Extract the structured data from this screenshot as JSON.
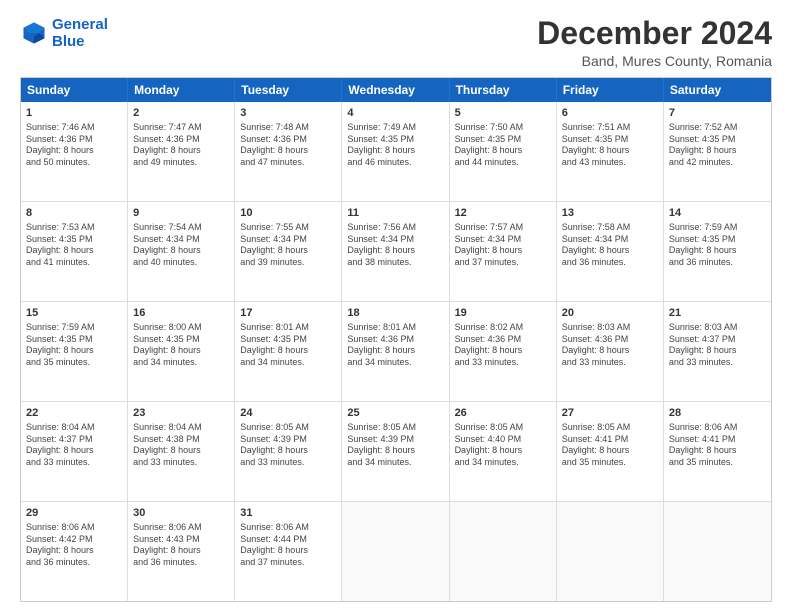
{
  "logo": {
    "line1": "General",
    "line2": "Blue"
  },
  "header": {
    "title": "December 2024",
    "subtitle": "Band, Mures County, Romania"
  },
  "days_of_week": [
    "Sunday",
    "Monday",
    "Tuesday",
    "Wednesday",
    "Thursday",
    "Friday",
    "Saturday"
  ],
  "weeks": [
    [
      {
        "day": "1",
        "lines": [
          "Sunrise: 7:46 AM",
          "Sunset: 4:36 PM",
          "Daylight: 8 hours",
          "and 50 minutes."
        ]
      },
      {
        "day": "2",
        "lines": [
          "Sunrise: 7:47 AM",
          "Sunset: 4:36 PM",
          "Daylight: 8 hours",
          "and 49 minutes."
        ]
      },
      {
        "day": "3",
        "lines": [
          "Sunrise: 7:48 AM",
          "Sunset: 4:36 PM",
          "Daylight: 8 hours",
          "and 47 minutes."
        ]
      },
      {
        "day": "4",
        "lines": [
          "Sunrise: 7:49 AM",
          "Sunset: 4:35 PM",
          "Daylight: 8 hours",
          "and 46 minutes."
        ]
      },
      {
        "day": "5",
        "lines": [
          "Sunrise: 7:50 AM",
          "Sunset: 4:35 PM",
          "Daylight: 8 hours",
          "and 44 minutes."
        ]
      },
      {
        "day": "6",
        "lines": [
          "Sunrise: 7:51 AM",
          "Sunset: 4:35 PM",
          "Daylight: 8 hours",
          "and 43 minutes."
        ]
      },
      {
        "day": "7",
        "lines": [
          "Sunrise: 7:52 AM",
          "Sunset: 4:35 PM",
          "Daylight: 8 hours",
          "and 42 minutes."
        ]
      }
    ],
    [
      {
        "day": "8",
        "lines": [
          "Sunrise: 7:53 AM",
          "Sunset: 4:35 PM",
          "Daylight: 8 hours",
          "and 41 minutes."
        ]
      },
      {
        "day": "9",
        "lines": [
          "Sunrise: 7:54 AM",
          "Sunset: 4:34 PM",
          "Daylight: 8 hours",
          "and 40 minutes."
        ]
      },
      {
        "day": "10",
        "lines": [
          "Sunrise: 7:55 AM",
          "Sunset: 4:34 PM",
          "Daylight: 8 hours",
          "and 39 minutes."
        ]
      },
      {
        "day": "11",
        "lines": [
          "Sunrise: 7:56 AM",
          "Sunset: 4:34 PM",
          "Daylight: 8 hours",
          "and 38 minutes."
        ]
      },
      {
        "day": "12",
        "lines": [
          "Sunrise: 7:57 AM",
          "Sunset: 4:34 PM",
          "Daylight: 8 hours",
          "and 37 minutes."
        ]
      },
      {
        "day": "13",
        "lines": [
          "Sunrise: 7:58 AM",
          "Sunset: 4:34 PM",
          "Daylight: 8 hours",
          "and 36 minutes."
        ]
      },
      {
        "day": "14",
        "lines": [
          "Sunrise: 7:59 AM",
          "Sunset: 4:35 PM",
          "Daylight: 8 hours",
          "and 36 minutes."
        ]
      }
    ],
    [
      {
        "day": "15",
        "lines": [
          "Sunrise: 7:59 AM",
          "Sunset: 4:35 PM",
          "Daylight: 8 hours",
          "and 35 minutes."
        ]
      },
      {
        "day": "16",
        "lines": [
          "Sunrise: 8:00 AM",
          "Sunset: 4:35 PM",
          "Daylight: 8 hours",
          "and 34 minutes."
        ]
      },
      {
        "day": "17",
        "lines": [
          "Sunrise: 8:01 AM",
          "Sunset: 4:35 PM",
          "Daylight: 8 hours",
          "and 34 minutes."
        ]
      },
      {
        "day": "18",
        "lines": [
          "Sunrise: 8:01 AM",
          "Sunset: 4:36 PM",
          "Daylight: 8 hours",
          "and 34 minutes."
        ]
      },
      {
        "day": "19",
        "lines": [
          "Sunrise: 8:02 AM",
          "Sunset: 4:36 PM",
          "Daylight: 8 hours",
          "and 33 minutes."
        ]
      },
      {
        "day": "20",
        "lines": [
          "Sunrise: 8:03 AM",
          "Sunset: 4:36 PM",
          "Daylight: 8 hours",
          "and 33 minutes."
        ]
      },
      {
        "day": "21",
        "lines": [
          "Sunrise: 8:03 AM",
          "Sunset: 4:37 PM",
          "Daylight: 8 hours",
          "and 33 minutes."
        ]
      }
    ],
    [
      {
        "day": "22",
        "lines": [
          "Sunrise: 8:04 AM",
          "Sunset: 4:37 PM",
          "Daylight: 8 hours",
          "and 33 minutes."
        ]
      },
      {
        "day": "23",
        "lines": [
          "Sunrise: 8:04 AM",
          "Sunset: 4:38 PM",
          "Daylight: 8 hours",
          "and 33 minutes."
        ]
      },
      {
        "day": "24",
        "lines": [
          "Sunrise: 8:05 AM",
          "Sunset: 4:39 PM",
          "Daylight: 8 hours",
          "and 33 minutes."
        ]
      },
      {
        "day": "25",
        "lines": [
          "Sunrise: 8:05 AM",
          "Sunset: 4:39 PM",
          "Daylight: 8 hours",
          "and 34 minutes."
        ]
      },
      {
        "day": "26",
        "lines": [
          "Sunrise: 8:05 AM",
          "Sunset: 4:40 PM",
          "Daylight: 8 hours",
          "and 34 minutes."
        ]
      },
      {
        "day": "27",
        "lines": [
          "Sunrise: 8:05 AM",
          "Sunset: 4:41 PM",
          "Daylight: 8 hours",
          "and 35 minutes."
        ]
      },
      {
        "day": "28",
        "lines": [
          "Sunrise: 8:06 AM",
          "Sunset: 4:41 PM",
          "Daylight: 8 hours",
          "and 35 minutes."
        ]
      }
    ],
    [
      {
        "day": "29",
        "lines": [
          "Sunrise: 8:06 AM",
          "Sunset: 4:42 PM",
          "Daylight: 8 hours",
          "and 36 minutes."
        ]
      },
      {
        "day": "30",
        "lines": [
          "Sunrise: 8:06 AM",
          "Sunset: 4:43 PM",
          "Daylight: 8 hours",
          "and 36 minutes."
        ]
      },
      {
        "day": "31",
        "lines": [
          "Sunrise: 8:06 AM",
          "Sunset: 4:44 PM",
          "Daylight: 8 hours",
          "and 37 minutes."
        ]
      },
      {
        "day": "",
        "lines": []
      },
      {
        "day": "",
        "lines": []
      },
      {
        "day": "",
        "lines": []
      },
      {
        "day": "",
        "lines": []
      }
    ]
  ]
}
